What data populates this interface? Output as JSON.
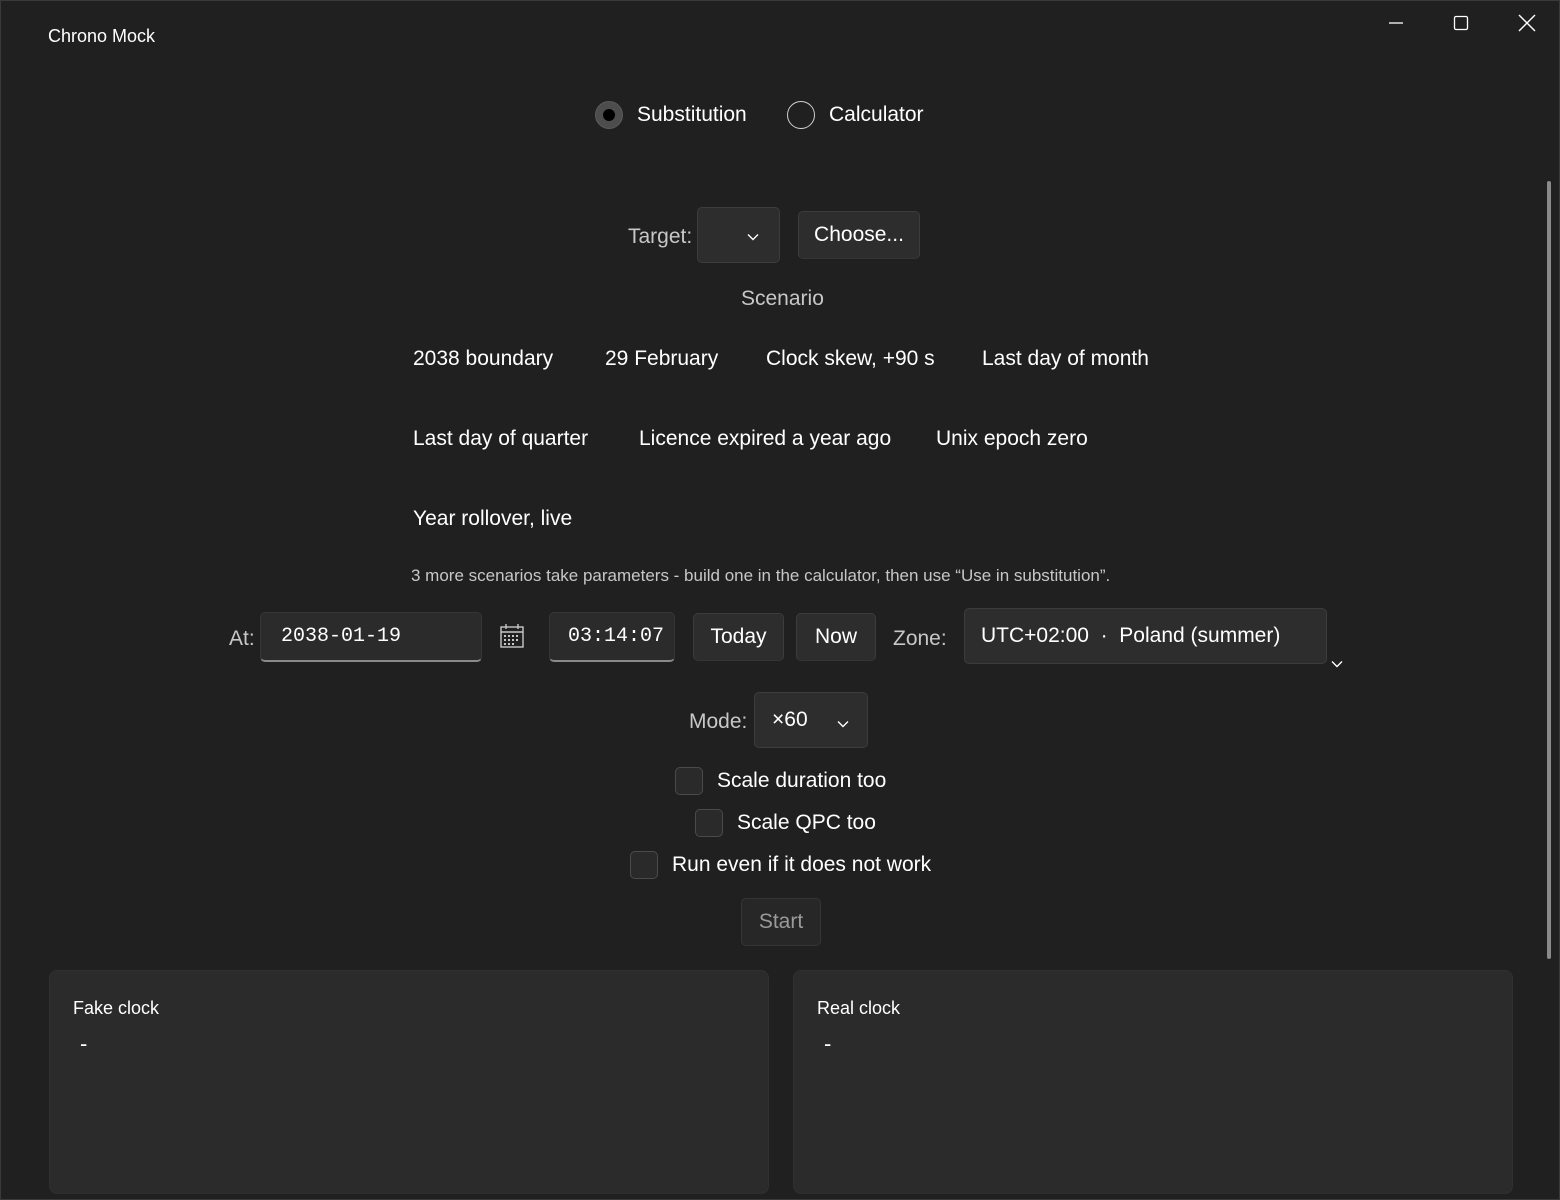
{
  "window": {
    "title": "Chrono Mock",
    "caption": {
      "minimize_icon": "minimize-icon",
      "maximize_icon": "maximize-icon",
      "close_icon": "close-icon"
    }
  },
  "mode_switch": {
    "options": [
      {
        "label": "Substitution",
        "checked": true
      },
      {
        "label": "Calculator",
        "checked": false
      }
    ]
  },
  "target": {
    "label": "Target:",
    "value": "",
    "choose_label": "Choose..."
  },
  "scenario": {
    "heading": "Scenario",
    "items": [
      "2038 boundary",
      "29 February",
      "Clock skew, +90 s",
      "Last day of month",
      "Last day of quarter",
      "Licence expired a year ago",
      "Unix epoch zero",
      "Year rollover, live"
    ],
    "hint": "3 more scenarios take parameters - build one in the calculator, then use “Use in substitution”."
  },
  "at": {
    "label": "At:",
    "date": "2038-01-19",
    "time": "03:14:07",
    "today_label": "Today",
    "now_label": "Now",
    "zone_label": "Zone:",
    "zone_value": "UTC+02:00  ·  Poland (summer)"
  },
  "mode": {
    "label": "Mode:",
    "value": "×60"
  },
  "options": {
    "scale_duration": {
      "label": "Scale duration too",
      "checked": false
    },
    "scale_qpc": {
      "label": "Scale QPC too",
      "checked": false
    },
    "run_anyway": {
      "label": "Run even if it does not work",
      "checked": false
    }
  },
  "start_label": "Start",
  "fake_clock": {
    "title": "Fake clock",
    "value": "-"
  },
  "real_clock": {
    "title": "Real clock",
    "value": "-"
  },
  "colors": {
    "background": "#202020",
    "control": "#2d2d2d",
    "panel": "#2b2b2b",
    "text": "#ffffff",
    "text_secondary": "#c7c7c7"
  }
}
